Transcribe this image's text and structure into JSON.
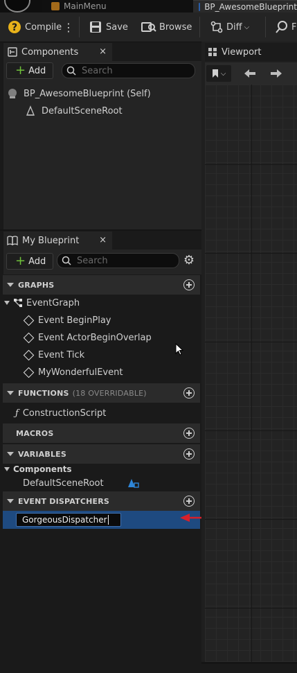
{
  "tabs": {
    "main_menu": "MainMenu",
    "blueprint": "BP_AwesomeBlueprint"
  },
  "toolbar": {
    "compile": "Compile",
    "save": "Save",
    "browse": "Browse",
    "diff": "Diff",
    "find_partial": "F"
  },
  "components_panel": {
    "title": "Components",
    "close": "×",
    "add_label": "Add",
    "search_placeholder": "Search",
    "items": [
      {
        "label": "BP_AwesomeBlueprint (Self)"
      },
      {
        "label": "DefaultSceneRoot"
      }
    ]
  },
  "viewport": {
    "tab_label": "Viewport"
  },
  "my_blueprint": {
    "title": "My Blueprint",
    "close": "×",
    "add_label": "Add",
    "search_placeholder": "Search",
    "sections": {
      "graphs": "GRAPHS",
      "functions": "FUNCTIONS",
      "functions_note": "(18 OVERRIDABLE)",
      "macros": "MACROS",
      "variables": "VARIABLES",
      "event_dispatchers": "EVENT DISPATCHERS"
    },
    "event_graph": "EventGraph",
    "events": [
      "Event BeginPlay",
      "Event ActorBeginOverlap",
      "Event Tick",
      "MyWonderfulEvent"
    ],
    "construction_script": "ConstructionScript",
    "variables_group": "Components",
    "variables_item": "DefaultSceneRoot",
    "dispatcher_value": "GorgeousDispatcher"
  },
  "colors": {
    "accent_blue": "#1e4a80",
    "annotation_red": "#d8202a",
    "add_green": "#6fc13a"
  }
}
